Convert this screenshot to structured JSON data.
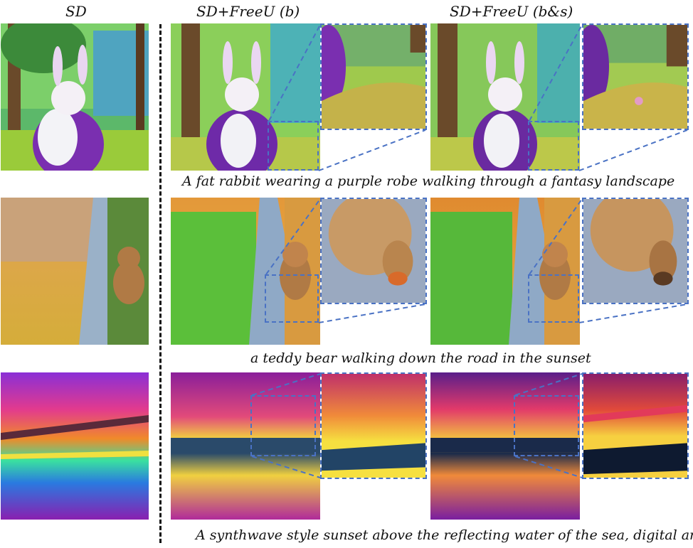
{
  "columns": {
    "sd": "SD",
    "freeu_b": "SD+FreeU (b)",
    "freeu_bs": "SD+FreeU (b&s)"
  },
  "captions": {
    "row1": "A fat rabbit wearing a purple robe walking through a fantasy landscape",
    "row2": "a teddy bear walking down the road in the sunset",
    "row3": "A synthwave style sunset above the reflecting water of the sea, digital art"
  },
  "colors": {
    "zoom_box": "#4a72c4",
    "divider": "#111111"
  }
}
